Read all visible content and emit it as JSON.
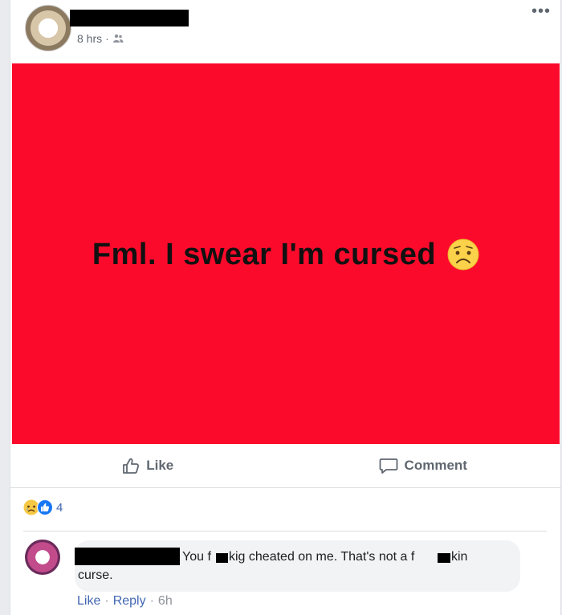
{
  "post": {
    "time": "8 hrs",
    "privacy_icon": "friends-icon",
    "more_label": "•••",
    "banner_text": "Fml. I swear I'm cursed",
    "banner_emoji": "worried-face",
    "banner_color": "#fc0a2b"
  },
  "actions": {
    "like_label": "Like",
    "comment_label": "Comment"
  },
  "reactions": {
    "count": "4",
    "icons": [
      "sad-reaction-icon",
      "like-reaction-icon"
    ]
  },
  "comment": {
    "text_seg1": "You f",
    "text_seg2": "kig cheated on me. That's not a f",
    "text_seg3": "kin",
    "text_line2": "curse.",
    "like_label": "Like",
    "reply_label": "Reply",
    "separator": "·",
    "time": "6h"
  }
}
